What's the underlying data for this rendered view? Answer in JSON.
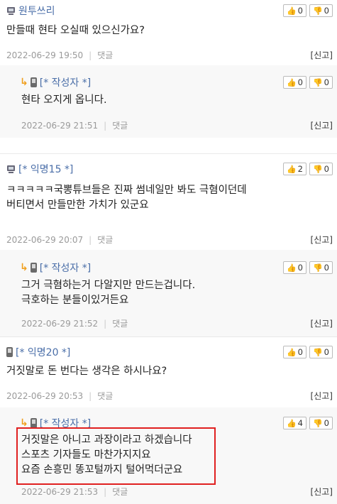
{
  "labels": {
    "reply": "댓글",
    "report": "[신고]",
    "thumb_up": "👍",
    "thumb_down": "👎"
  },
  "comments": [
    {
      "kind": "top",
      "author": "원투쓰리",
      "device_icon": "pc-icon",
      "text": "만들때 현타 오실때 있으신가요?",
      "time": "2022-06-29 19:50",
      "up": "0",
      "down": "0"
    },
    {
      "kind": "reply",
      "author": "[* 작성자 *]",
      "device_icon": "mobile-icon",
      "text": "현타 오지게 옵니다.",
      "time": "2022-06-29 21:51",
      "up": "0",
      "down": "0"
    },
    {
      "kind": "top",
      "author": "[* 익명15 *]",
      "device_icon": "pc-icon",
      "text": "ㅋㅋㅋㅋㅋ국뽕튜브들은 진짜 썸네일만 봐도 극혐이던데\n버티면서 만들만한 가치가 있군요",
      "time": "2022-06-29 20:07",
      "up": "2",
      "down": "0"
    },
    {
      "kind": "reply",
      "author": "[* 작성자 *]",
      "device_icon": "mobile-icon",
      "text": "그거 극혐하는거 다알지만 만드는겁니다.\n극호하는 분들이있거든요",
      "time": "2022-06-29 21:52",
      "up": "0",
      "down": "0"
    },
    {
      "kind": "top",
      "author": "[* 익명20 *]",
      "device_icon": "mobile-icon",
      "text": "거짓말로 돈 번다는 생각은 하시나요?",
      "time": "2022-06-29 20:53",
      "up": "0",
      "down": "0"
    },
    {
      "kind": "reply",
      "author": "[* 작성자 *]",
      "device_icon": "mobile-icon",
      "text": "거짓말은 아니고 과장이라고 하겠습니다\n스포츠 기자들도 마찬가지지요\n요즘 손흥민 똥꼬털까지 털어먹더군요",
      "time": "2022-06-29 21:53",
      "up": "4",
      "down": "0"
    }
  ]
}
